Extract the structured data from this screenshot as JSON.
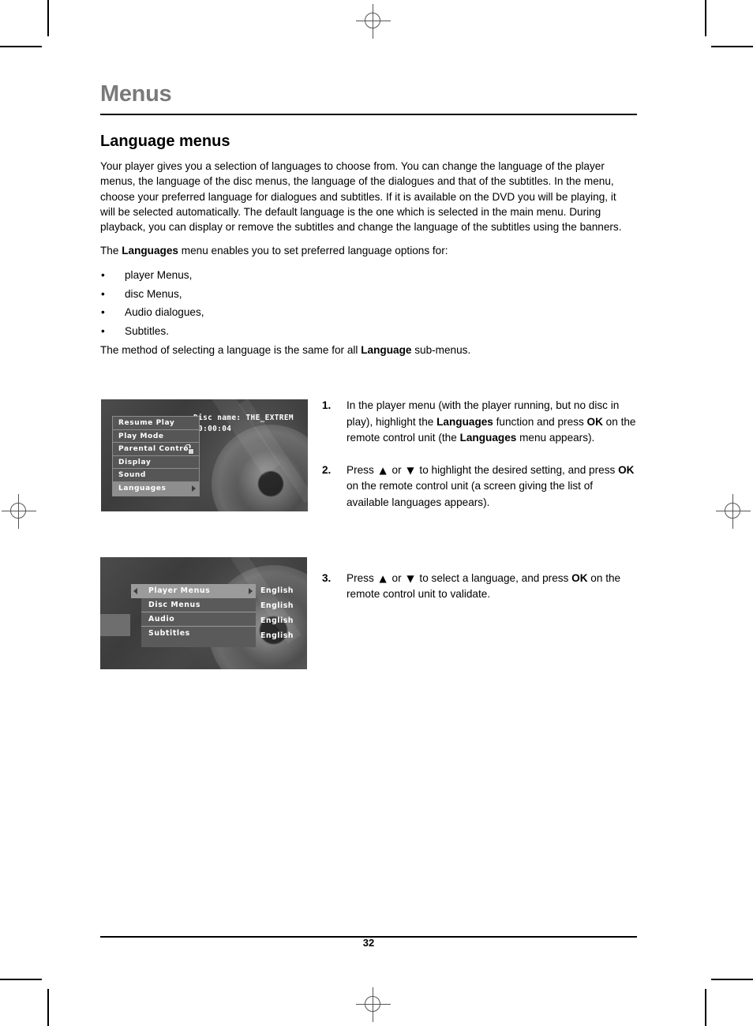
{
  "document": {
    "chapter_title": "Menus",
    "section_title": "Language menus",
    "page_number": "32"
  },
  "intro": {
    "paragraph": "Your player gives you a selection of languages to choose from. You can change the language of the player menus, the language of the disc menus, the language of the dialogues and that of the subtitles. In the menu, choose your preferred language for dialogues and subtitles. If it is available on the DVD you will be playing, it will be selected automatically. The default language is the one which is selected in the main menu. During playback, you can display or remove the subtitles and change the language of the subtitles using the banners."
  },
  "options_intro": {
    "before": "The ",
    "bold": "Languages",
    "after": " menu enables you to set preferred language options for:"
  },
  "bullets": [
    {
      "marker": "•",
      "label": "player Menus,"
    },
    {
      "marker": "•",
      "label": "disc Menus,"
    },
    {
      "marker": "•",
      "label": "Audio dialogues,"
    },
    {
      "marker": "•",
      "label": "Subtitles."
    }
  ],
  "closing": {
    "before": "The method of selecting a language is the same for all ",
    "bold": "Language",
    "after": " sub-menus."
  },
  "steps": [
    {
      "number": "1.",
      "seg1": "In the player menu (with the player running, but no disc in play), highlight the ",
      "bold1": "Languages",
      "seg2": " function and press ",
      "bold2": "OK",
      "seg3": " on the remote control unit (the ",
      "bold3": "Languages",
      "seg4": " menu appears)."
    },
    {
      "number": "2.",
      "seg1": "Press ",
      "arrow_up": "▲",
      "seg_or": " or ",
      "arrow_down": "▼",
      "seg2": " to highlight the desired setting, and press ",
      "bold2": "OK",
      "seg3": " on the remote control unit (a screen giving the list of available languages appears)."
    },
    {
      "number": "3.",
      "seg1": "Press ",
      "arrow_up": "▲",
      "seg_or": " or ",
      "arrow_down": "▼",
      "seg2": " to select a language, and press ",
      "bold2": "OK",
      "seg3": " on the remote control unit to validate."
    }
  ],
  "screenshot_player_menu": {
    "disc_name_label": "Disc name: THE_EXTREM",
    "elapsed_time": "00:00:04",
    "items": [
      {
        "label": "Resume Play",
        "selected": false
      },
      {
        "label": "Play Mode",
        "selected": false
      },
      {
        "label": "Parental Control",
        "selected": false,
        "icon": "lock-icon"
      },
      {
        "label": "Display",
        "selected": false
      },
      {
        "label": "Sound",
        "selected": false
      },
      {
        "label": "Languages",
        "selected": true,
        "icon": "chevron-right-icon"
      }
    ]
  },
  "screenshot_language_menu": {
    "rows": [
      {
        "label": "Player Menus",
        "value": "English",
        "selected": true
      },
      {
        "label": "Disc Menus",
        "value": "English",
        "selected": false
      },
      {
        "label": "Audio",
        "value": "English",
        "selected": false
      },
      {
        "label": "Subtitles",
        "value": "English",
        "selected": false
      }
    ]
  },
  "colors": {
    "chapter_title": "#7a7a7a",
    "body_text": "#000000",
    "menu_panel": "#565656",
    "menu_highlight": "#8e8e8e",
    "screen_background": "#3a3a3a"
  }
}
